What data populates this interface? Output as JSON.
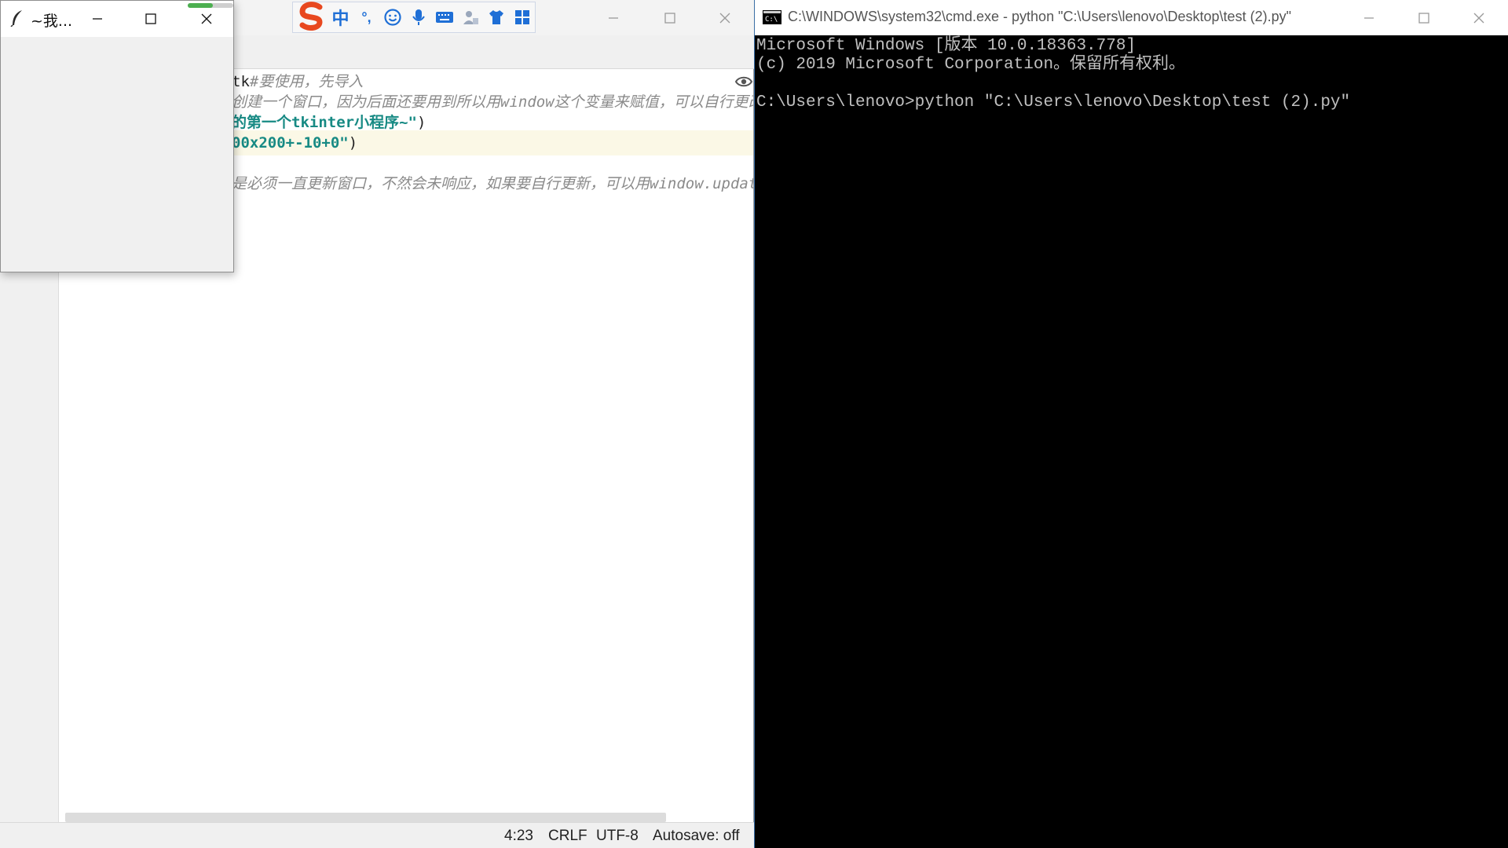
{
  "editor": {
    "code_lines": [
      {
        "segments": [
          {
            "text": "tk",
            "kind": "default"
          },
          {
            "text": "#要使用，先导入",
            "kind": "comment"
          }
        ]
      },
      {
        "segments": [
          {
            "text": "创建一个窗口，因为后面还要用到所以用window这个变量来赋值，可以自行更改",
            "kind": "comment"
          }
        ]
      },
      {
        "segments": [
          {
            "text": "的第一个tkinter小程序~\"",
            "kind": "string"
          },
          {
            "text": ")",
            "kind": "default"
          }
        ]
      },
      {
        "segments": [
          {
            "text": "00x200+-10+0\"",
            "kind": "string"
          },
          {
            "text": ")",
            "kind": "default"
          }
        ]
      },
      {
        "segments": [
          {
            "text": "",
            "kind": "default"
          }
        ]
      },
      {
        "segments": [
          {
            "text": "是必须一直更新窗口，不然会未响应，如果要自行更新，可以用window.update",
            "kind": "comment"
          }
        ]
      }
    ],
    "status": {
      "position": "4:23",
      "line_ending": "CRLF",
      "encoding": "UTF-8",
      "autosave": "Autosave: off"
    }
  },
  "ime": {
    "items": [
      "中",
      "°,",
      "☺",
      "mic",
      "keyboard",
      "user",
      "shirt",
      "grid"
    ]
  },
  "tk_window": {
    "title": "~我...",
    "progress_fraction": 0.55
  },
  "cmd": {
    "title": "C:\\WINDOWS\\system32\\cmd.exe - python  \"C:\\Users\\lenovo\\Desktop\\test (2).py\"",
    "lines": [
      "Microsoft Windows [版本 10.0.18363.778]",
      "(c) 2019 Microsoft Corporation。保留所有权利。",
      "",
      "C:\\Users\\lenovo>python \"C:\\Users\\lenovo\\Desktop\\test (2).py\""
    ]
  },
  "colors": {
    "comment": "#8a8a8a",
    "string": "#178a84",
    "current_line": "#fbf8e6",
    "cmd_bg": "#000000",
    "cmd_fg": "#c0c0c0",
    "ime_blue": "#1f6fd6",
    "ime_red": "#e8481f"
  }
}
